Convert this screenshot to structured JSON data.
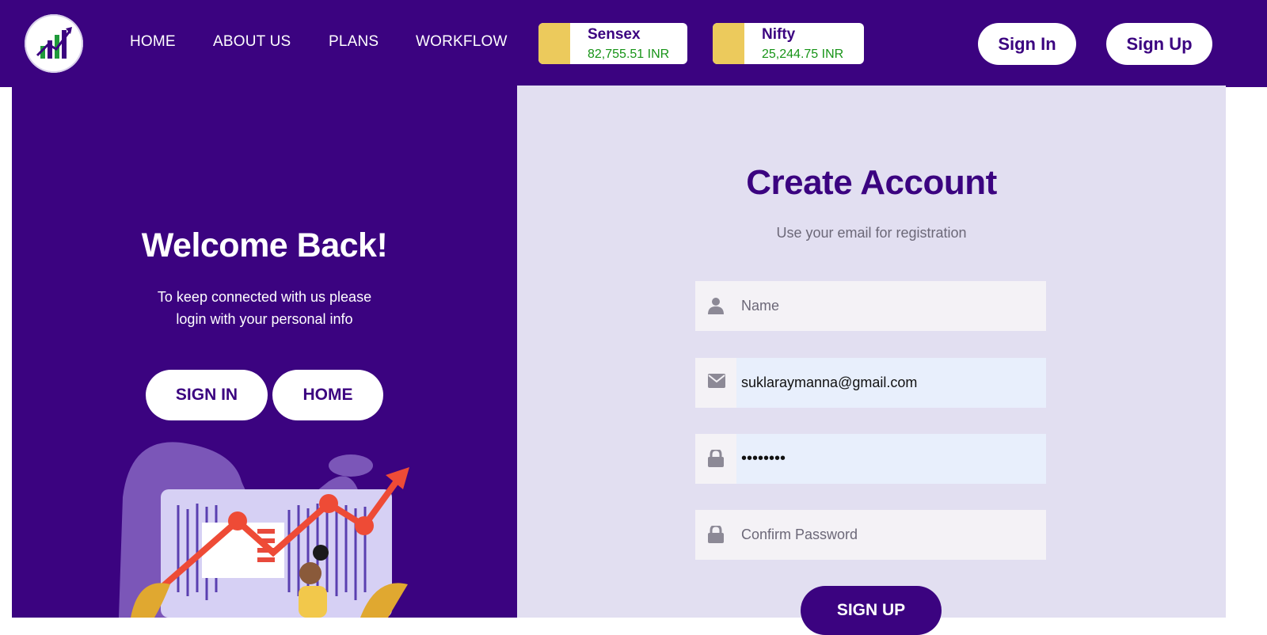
{
  "nav": {
    "links": [
      "HOME",
      "ABOUT US",
      "PLANS",
      "WORKFLOW"
    ],
    "tickers": [
      {
        "name": "Sensex",
        "value": "82,755.51 INR"
      },
      {
        "name": "Nifty",
        "value": "25,244.75 INR"
      }
    ],
    "sign_in_label": "Sign In",
    "sign_up_label": "Sign Up"
  },
  "left": {
    "title": "Welcome Back!",
    "subtitle_line1": "To keep connected with us please",
    "subtitle_line2": "login with your personal info",
    "sign_in_button": "SIGN IN",
    "home_button": "HOME"
  },
  "form": {
    "title": "Create Account",
    "subtitle": "Use your email for registration",
    "name_placeholder": "Name",
    "email_value": "suklaraymanna@gmail.com",
    "password_value": "••••••••",
    "confirm_placeholder": "Confirm Password",
    "submit_label": "SIGN UP"
  },
  "colors": {
    "brand": "#3b0380",
    "ticker_swatch": "#ecca5c",
    "ticker_value": "#179417",
    "form_bg": "#e2dff1",
    "field_bg": "#f4f2f6",
    "autofill_bg": "#e8effc"
  },
  "icons": [
    "logo-chart-icon",
    "user-icon",
    "envelope-icon",
    "lock-icon"
  ]
}
